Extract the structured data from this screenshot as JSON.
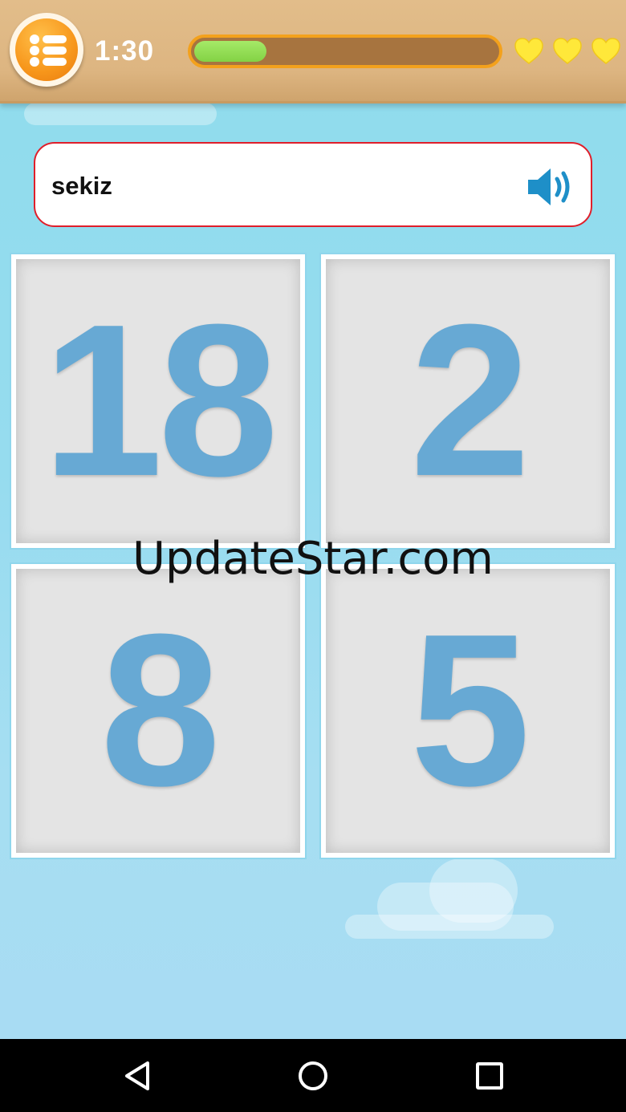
{
  "game": {
    "timer": "1:30",
    "progress_fraction": 0.24,
    "lives": 3
  },
  "question": {
    "word": "sekiz",
    "speaker_icon": "speaker-icon"
  },
  "cards": [
    {
      "label": "18"
    },
    {
      "label": "2"
    },
    {
      "label": "8"
    },
    {
      "label": "5"
    }
  ],
  "watermark": "UpdateStar.com",
  "colors": {
    "topbar": "#ddb581",
    "progress_track": "#a7743f",
    "progress_border": "#f3a11c",
    "progress_fill": "#83d244",
    "heart": "#ffe83a",
    "question_border": "#e01e2a",
    "speaker": "#1e8fc8",
    "card_number": "#67a9d4"
  },
  "navigation": {
    "back_icon": "back-triangle-icon",
    "home_icon": "home-circle-icon",
    "recents_icon": "recents-square-icon"
  }
}
